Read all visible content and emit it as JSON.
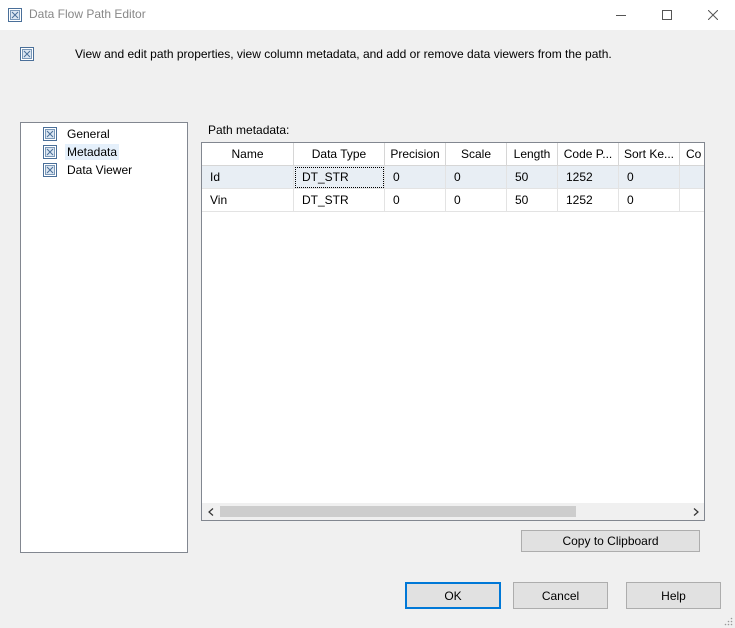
{
  "window": {
    "title": "Data Flow Path Editor",
    "icons": {
      "app": "dataflow-path-icon",
      "minimize": "minimize-icon",
      "maximize": "maximize-icon",
      "close": "close-icon"
    }
  },
  "header": {
    "description": "View and edit path properties, view column metadata, and add or remove data viewers from the path."
  },
  "nav": {
    "items": [
      {
        "label": "General",
        "selected": false
      },
      {
        "label": "Metadata",
        "selected": true
      },
      {
        "label": "Data Viewer",
        "selected": false
      }
    ]
  },
  "metadata": {
    "label": "Path metadata:",
    "columns": [
      "Name",
      "Data Type",
      "Precision",
      "Scale",
      "Length",
      "Code P...",
      "Sort Ke...",
      "Co"
    ],
    "rows": [
      [
        "Id",
        "DT_STR",
        "0",
        "0",
        "50",
        "1252",
        "0",
        ""
      ],
      [
        "Vin",
        "DT_STR",
        "0",
        "0",
        "50",
        "1252",
        "0",
        ""
      ]
    ],
    "selected_row": 0
  },
  "buttons": {
    "copy": "Copy to Clipboard",
    "ok": "OK",
    "cancel": "Cancel",
    "help": "Help"
  },
  "colors": {
    "accent": "#0078d7",
    "selection": "#e5f0fb",
    "background": "#f0f0f0"
  }
}
